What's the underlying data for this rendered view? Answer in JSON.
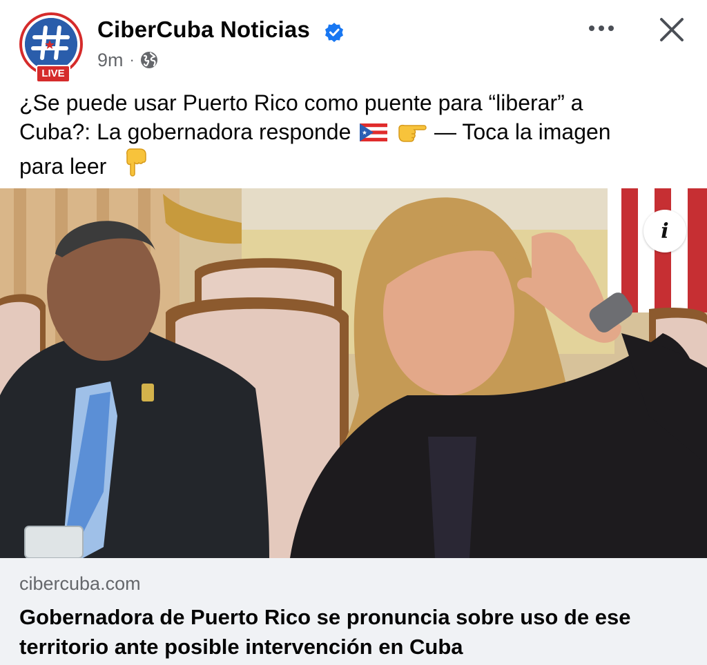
{
  "post": {
    "page_name": "CiberCuba Noticias",
    "live_badge": "LIVE",
    "time": "9m",
    "separator": "·",
    "audience_icon": "globe-icon",
    "verified_icon": "verified-badge-icon",
    "more_icon": "more-options-icon",
    "close_icon": "close-icon",
    "caption": {
      "line1": "¿Se puede usar Puerto Rico como puente para “liberar” a",
      "line2_start": "Cuba?: La gobernadora responde",
      "line2_end": "— Toca la imagen",
      "line3": "para leer",
      "emoji_flag": "puerto-rico-flag",
      "emoji_point_right": "pointing-right-hand",
      "emoji_point_down": "pointing-down-hand"
    }
  },
  "photo": {
    "info_label": "i"
  },
  "link": {
    "domain": "cibercuba.com",
    "title": "Gobernadora de Puerto Rico se pronuncia sobre uso de ese territorio ante posible intervención en Cuba"
  },
  "colors": {
    "brand_blue": "#2a5dab",
    "live_red": "#d52b2b",
    "verified_blue": "#1877f2",
    "meta_gray": "#65676b",
    "link_bg": "#f0f2f5"
  }
}
